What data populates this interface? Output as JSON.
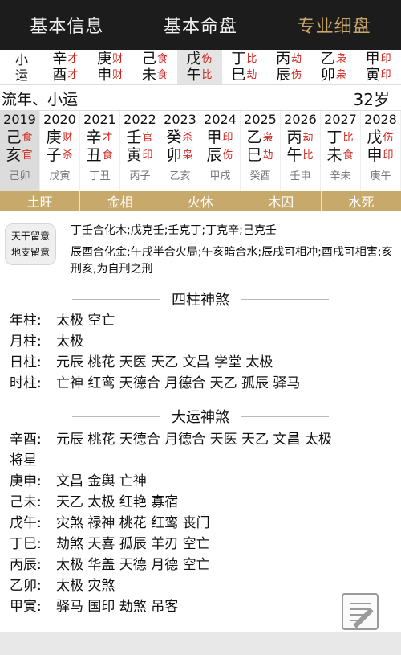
{
  "tabs": [
    {
      "label": "基本信息"
    },
    {
      "label": "基本命盘"
    },
    {
      "label": "专业细盘"
    }
  ],
  "dayun": {
    "label_top": "小",
    "label_bottom": "运",
    "cells": [
      {
        "g1": "辛",
        "s1": "才",
        "g2": "酉",
        "s2": "才"
      },
      {
        "g1": "庚",
        "s1": "财",
        "g2": "申",
        "s2": "财"
      },
      {
        "g1": "己",
        "s1": "食",
        "g2": "未",
        "s2": "食"
      },
      {
        "g1": "戊",
        "s1": "伤",
        "g2": "午",
        "s2": "比"
      },
      {
        "g1": "丁",
        "s1": "比",
        "g2": "巳",
        "s2": "劫"
      },
      {
        "g1": "丙",
        "s1": "劫",
        "g2": "辰",
        "s2": "伤"
      },
      {
        "g1": "乙",
        "s1": "枭",
        "g2": "卯",
        "s2": "枭"
      },
      {
        "g1": "甲",
        "s1": "印",
        "g2": "寅",
        "s2": "印"
      }
    ]
  },
  "liunian": {
    "title": "流年、小运",
    "age": "32岁"
  },
  "years": [
    {
      "year": "2019",
      "g1": "己",
      "s1": "食",
      "g2": "亥",
      "s2": "官",
      "xy": "己卯"
    },
    {
      "year": "2020",
      "g1": "庚",
      "s1": "财",
      "g2": "子",
      "s2": "杀",
      "xy": "戊寅"
    },
    {
      "year": "2021",
      "g1": "辛",
      "s1": "才",
      "g2": "丑",
      "s2": "食",
      "xy": "丁丑"
    },
    {
      "year": "2022",
      "g1": "壬",
      "s1": "官",
      "g2": "寅",
      "s2": "印",
      "xy": "丙子"
    },
    {
      "year": "2023",
      "g1": "癸",
      "s1": "杀",
      "g2": "卯",
      "s2": "枭",
      "xy": "乙亥"
    },
    {
      "year": "2024",
      "g1": "甲",
      "s1": "印",
      "g2": "辰",
      "s2": "伤",
      "xy": "甲戌"
    },
    {
      "year": "2025",
      "g1": "乙",
      "s1": "枭",
      "g2": "巳",
      "s2": "劫",
      "xy": "癸酉"
    },
    {
      "year": "2026",
      "g1": "丙",
      "s1": "劫",
      "g2": "午",
      "s2": "比",
      "xy": "壬申"
    },
    {
      "year": "2027",
      "g1": "丁",
      "s1": "比",
      "g2": "未",
      "s2": "食",
      "xy": "辛未"
    },
    {
      "year": "2028",
      "g1": "戊",
      "s1": "伤",
      "g2": "申",
      "s2": "印",
      "xy": "庚午"
    }
  ],
  "wuxing": [
    "土旺",
    "金相",
    "火休",
    "木囚",
    "水死"
  ],
  "badge": {
    "line1": "天干留意",
    "line2": "地支留意"
  },
  "hehua": {
    "tiangan": "丁壬合化木;戊克壬;壬克丁;丁克辛;己克壬",
    "dizhi": "辰酉合化金;午戌半合火局;午亥暗合水;辰戌可相冲;酉戌可相害;亥刑亥,为自刑之刑"
  },
  "sizhu": {
    "title": "四柱神煞",
    "rows": [
      {
        "k": "年柱:",
        "v": "太极 空亡"
      },
      {
        "k": "月柱:",
        "v": "太极"
      },
      {
        "k": "日柱:",
        "v": "元辰 桃花 天医 天乙 文昌 学堂 太极"
      },
      {
        "k": "时柱:",
        "v": "亡神 红鸾 天德合 月德合 天乙 孤辰 驿马"
      }
    ]
  },
  "dayun_shensha": {
    "title": "大运神煞",
    "rows": [
      {
        "k": "辛酉:",
        "v": "元辰 桃花 天德合 月德合 天医 天乙 文昌 太极"
      },
      {
        "k": "",
        "v": "将星"
      },
      {
        "k": "庚申:",
        "v": "文昌 金舆 亡神"
      },
      {
        "k": "己未:",
        "v": "天乙 太极 红艳 寡宿"
      },
      {
        "k": "戊午:",
        "v": "灾煞 禄神 桃花 红鸾 丧门"
      },
      {
        "k": "丁巳:",
        "v": "劫煞 天喜 孤辰 羊刃 空亡"
      },
      {
        "k": "丙辰:",
        "v": "太极 华盖 天德 月德 空亡"
      },
      {
        "k": "乙卯:",
        "v": "太极 灾煞"
      },
      {
        "k": "甲寅:",
        "v": "驿马 国印 劫煞 吊客"
      }
    ]
  },
  "colors": {
    "accent": "#c9a76a",
    "god_red": "#d0261e",
    "topbar": "#1c1c1c",
    "wuxing_bar": "#c8a96c"
  },
  "icons": {
    "fab": "edit-note-icon"
  }
}
